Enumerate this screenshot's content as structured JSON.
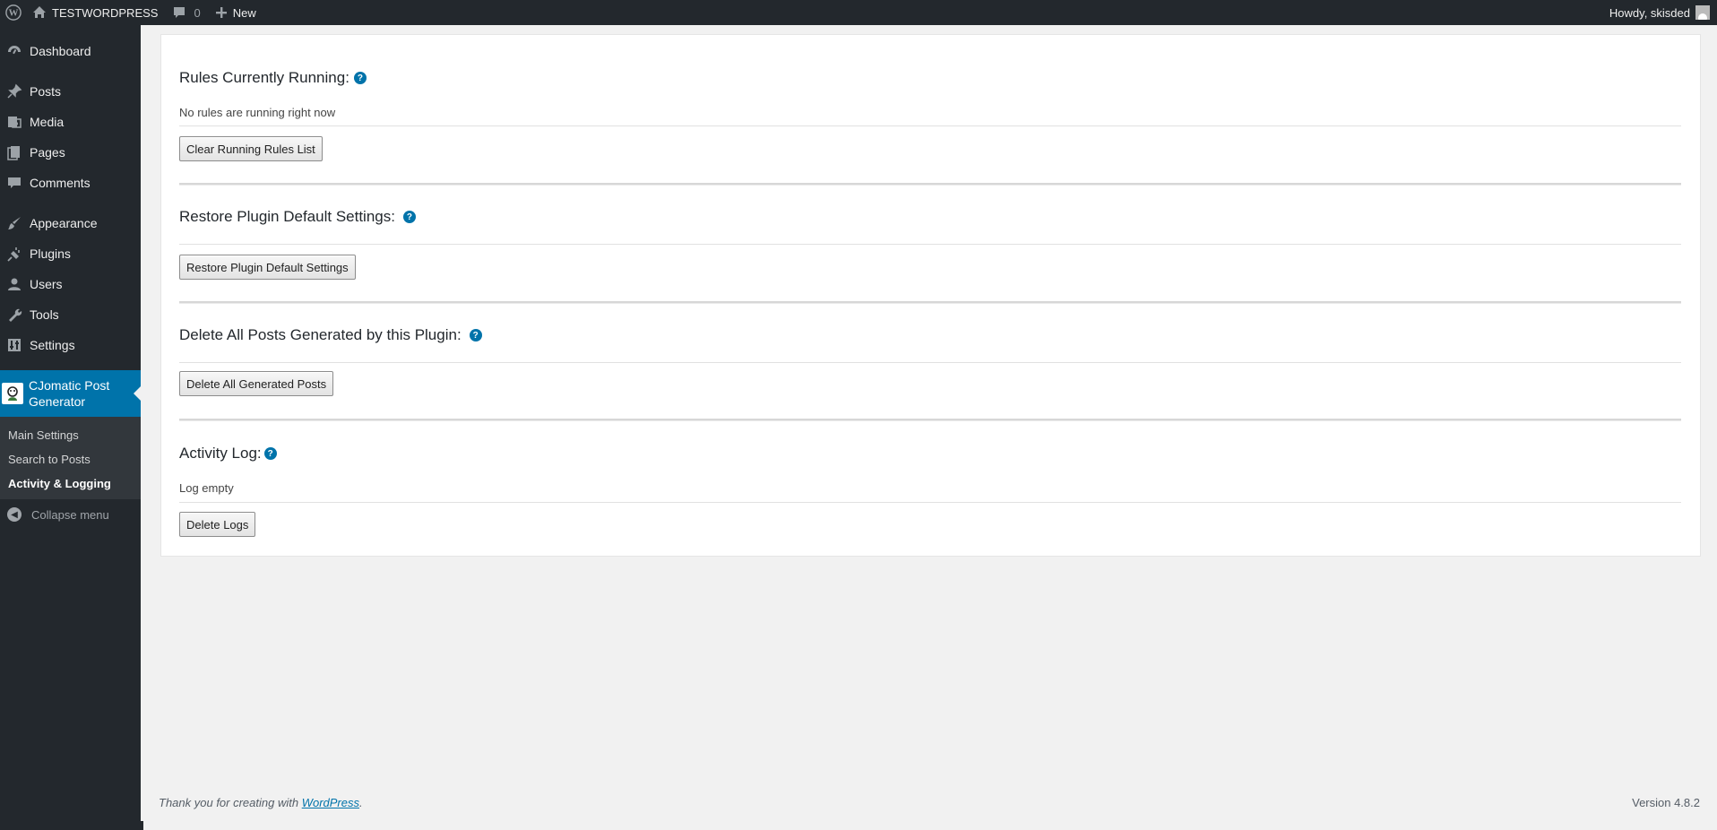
{
  "adminbar": {
    "site_name": "TESTWORDPRESS",
    "comments_count": "0",
    "new_label": "New",
    "howdy": "Howdy, skisded"
  },
  "sidebar": {
    "items": [
      {
        "label": "Dashboard",
        "icon": "dashboard-icon"
      },
      {
        "label": "Posts",
        "icon": "pin-icon"
      },
      {
        "label": "Media",
        "icon": "media-icon"
      },
      {
        "label": "Pages",
        "icon": "pages-icon"
      },
      {
        "label": "Comments",
        "icon": "comment-icon"
      },
      {
        "label": "Appearance",
        "icon": "brush-icon"
      },
      {
        "label": "Plugins",
        "icon": "plug-icon"
      },
      {
        "label": "Users",
        "icon": "user-icon"
      },
      {
        "label": "Tools",
        "icon": "wrench-icon"
      },
      {
        "label": "Settings",
        "icon": "settings-icon"
      }
    ],
    "current": {
      "label_line1": "CJomatic Post",
      "label_line2": "Generator"
    },
    "submenu": [
      "Main Settings",
      "Search to Posts",
      "Activity & Logging"
    ],
    "collapse": "Collapse menu"
  },
  "main": {
    "rules_title": "Rules Currently Running:",
    "rules_status": "No rules are running right now",
    "rules_button": "Clear Running Rules List",
    "restore_title": "Restore Plugin Default Settings:",
    "restore_button": "Restore Plugin Default Settings",
    "delete_title": "Delete All Posts Generated by this Plugin:",
    "delete_button": "Delete All Generated Posts",
    "log_title": "Activity Log:",
    "log_status": "Log empty",
    "log_button": "Delete Logs",
    "help_glyph": "?"
  },
  "footer": {
    "thanks_prefix": "Thank you for creating with ",
    "thanks_link": "WordPress",
    "thanks_suffix": ".",
    "version": "Version 4.8.2"
  },
  "colors": {
    "adminbar_bg": "#23282d",
    "accent": "#0073aa",
    "page_bg": "#f1f1f1"
  }
}
